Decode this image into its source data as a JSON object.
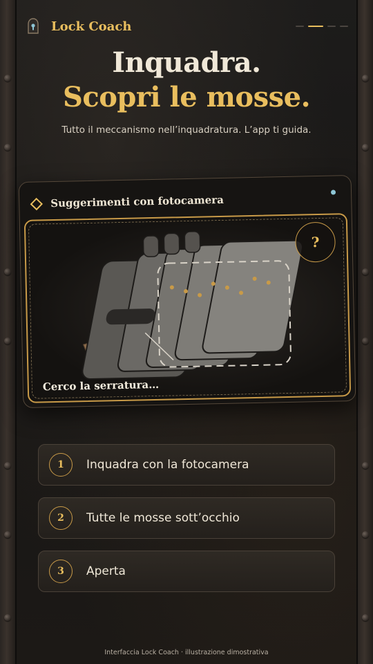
{
  "header": {
    "app_name": "Lock Coach",
    "app_icon": "lock-icon",
    "pager": {
      "total": 4,
      "active": 1
    }
  },
  "hero": {
    "title_line1": "Inquadra.",
    "title_line2": "Scopri le mosse.",
    "subtitle": "Tutto il meccanismo nell’inquadratura. L’app ti guida."
  },
  "camera_card": {
    "title": "Suggerimenti con fotocamera",
    "icon": "diamond-icon",
    "help_label": "?",
    "status_text": "Cerco la serratura…",
    "status_color": "#8ec6d6"
  },
  "steps": [
    {
      "number": "1",
      "label": "Inquadra con la fotocamera"
    },
    {
      "number": "2",
      "label": "Tutte le mosse sott’occhio"
    },
    {
      "number": "3",
      "label": "Aperta"
    }
  ],
  "footer": {
    "caption": "Interfaccia Lock Coach · illustrazione dimostrativa"
  },
  "colors": {
    "accent": "#e9be5e",
    "background": "#1a1816",
    "card_border": "#c89a48"
  }
}
